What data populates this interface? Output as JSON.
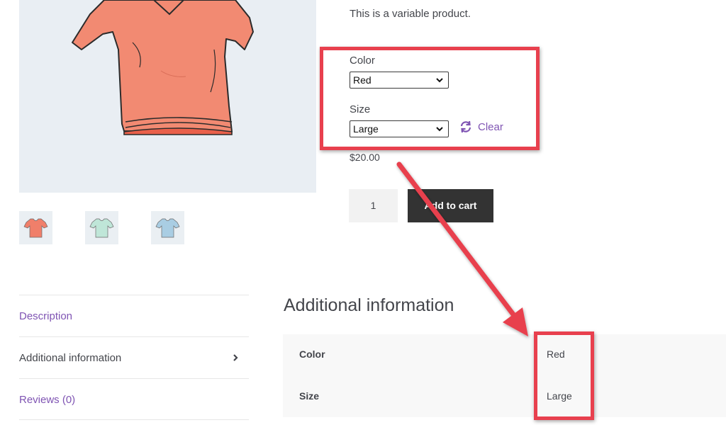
{
  "product": {
    "short_description": "This is a variable product.",
    "price": "$20.00",
    "quantity": "1",
    "add_to_cart_label": "Add to cart"
  },
  "variations": {
    "color": {
      "label": "Color",
      "selected": "Red"
    },
    "size": {
      "label": "Size",
      "selected": "Large"
    },
    "clear_label": "Clear"
  },
  "gallery": {
    "thumbnails": [
      {
        "color": "#f07f6a"
      },
      {
        "color": "#bfe6d8"
      },
      {
        "color": "#a9cde3"
      }
    ]
  },
  "tabs": [
    {
      "label": "Description"
    },
    {
      "label": "Additional information"
    },
    {
      "label": "Reviews (0)"
    }
  ],
  "additional_info": {
    "title": "Additional information",
    "rows": [
      {
        "name": "Color",
        "value": "Red"
      },
      {
        "name": "Size",
        "value": "Large"
      }
    ]
  },
  "colors": {
    "accent": "#7f54b3",
    "button": "#333333",
    "annotation": "#e8404e",
    "shirt": "#f28a72"
  },
  "icons": {
    "clear": "refresh-icon",
    "tab_active": "chevron-right-icon",
    "select": "chevron-down-icon"
  }
}
